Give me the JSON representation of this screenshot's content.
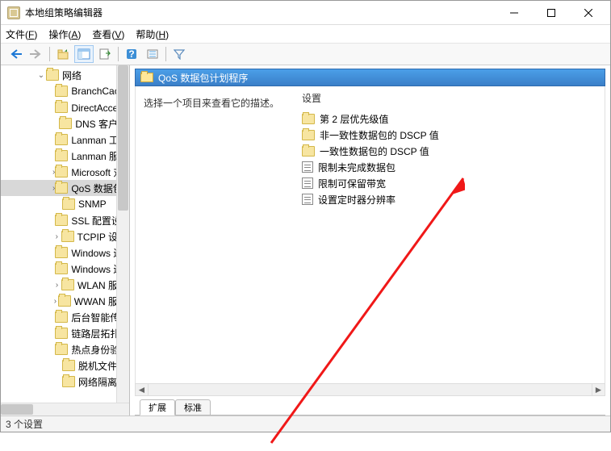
{
  "window": {
    "title": "本地组策略编辑器"
  },
  "menubar": [
    {
      "label": "文件",
      "key": "F"
    },
    {
      "label": "操作",
      "key": "A"
    },
    {
      "label": "查看",
      "key": "V"
    },
    {
      "label": "帮助",
      "key": "H"
    }
  ],
  "tree": {
    "root": {
      "label": "网络",
      "expanded": true
    },
    "items": [
      {
        "label": "BranchCache",
        "has_children": false
      },
      {
        "label": "DirectAccess 客户端体验设置",
        "has_children": false
      },
      {
        "label": "DNS 客户端",
        "has_children": false
      },
      {
        "label": "Lanman 工作站",
        "has_children": false
      },
      {
        "label": "Lanman 服务器",
        "has_children": false
      },
      {
        "label": "Microsoft 对等网络服务",
        "has_children": true
      },
      {
        "label": "QoS 数据包计划程序",
        "has_children": true,
        "selected": true
      },
      {
        "label": "SNMP",
        "has_children": false
      },
      {
        "label": "SSL 配置设置",
        "has_children": false
      },
      {
        "label": "TCPIP 设置",
        "has_children": true
      },
      {
        "label": "Windows 连接管理器",
        "has_children": false
      },
      {
        "label": "Windows 连接立即连接",
        "has_children": false
      },
      {
        "label": "WLAN 服务",
        "has_children": true
      },
      {
        "label": "WWAN 服务",
        "has_children": true
      },
      {
        "label": "后台智能传输服务 (BITS)",
        "has_children": false
      },
      {
        "label": "链路层拓扑发现",
        "has_children": false
      },
      {
        "label": "热点身份验证",
        "has_children": false
      },
      {
        "label": "脱机文件",
        "has_children": false
      },
      {
        "label": "网络隔离",
        "has_children": false
      }
    ]
  },
  "main": {
    "header": "QoS 数据包计划程序",
    "description": "选择一个项目来查看它的描述。",
    "settings_col_header": "设置",
    "items": [
      {
        "type": "folder",
        "label": "第 2 层优先级值"
      },
      {
        "type": "folder",
        "label": "非一致性数据包的 DSCP 值"
      },
      {
        "type": "folder",
        "label": "一致性数据包的 DSCP 值"
      },
      {
        "type": "setting",
        "label": "限制未完成数据包"
      },
      {
        "type": "setting",
        "label": "限制可保留带宽"
      },
      {
        "type": "setting",
        "label": "设置定时器分辨率"
      }
    ]
  },
  "tabs": {
    "extended": "扩展",
    "standard": "标准"
  },
  "status": "3 个设置"
}
